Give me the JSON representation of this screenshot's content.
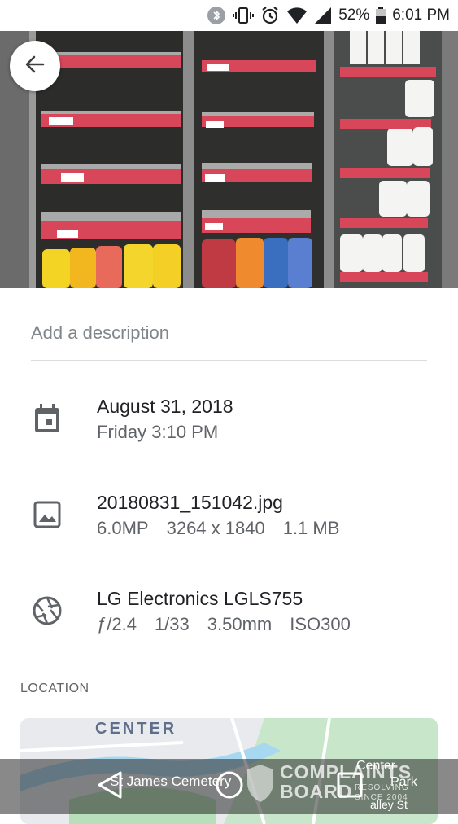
{
  "status_bar": {
    "battery": "52%",
    "time": "6:01 PM",
    "icons": [
      "bluetooth-icon",
      "vibrate-icon",
      "alarm-icon",
      "wifi-icon",
      "signal-icon",
      "battery-icon"
    ]
  },
  "photo": {
    "icons": [
      "back-arrow-icon"
    ]
  },
  "details": {
    "description_placeholder": "Add a description",
    "date": {
      "icon": "calendar-icon",
      "date": "August 31, 2018",
      "day_time": "Friday 3:10 PM"
    },
    "file": {
      "icon": "image-icon",
      "filename": "20180831_151042.jpg",
      "megapixels": "6.0MP",
      "resolution": "3264 x 1840",
      "size": "1.1 MB"
    },
    "camera": {
      "icon": "aperture-icon",
      "model": "LG Electronics LGLS755",
      "aperture": "ƒ/2.4",
      "shutter": "1/33",
      "focal_length": "3.50mm",
      "iso": "ISO300"
    },
    "location_label": "LOCATION"
  },
  "map": {
    "labels": {
      "center": "CENTER",
      "cemetery": "St James Cemetery",
      "center_right": "Center",
      "park": "Park",
      "street": "alley St"
    }
  },
  "watermark": {
    "line1": "COMPLAINTS",
    "line2": "BOARD",
    "line3": "RESOLVING",
    "line4": "SINCE 2004"
  },
  "nav_bar": {
    "icons": [
      "back-triangle-icon",
      "home-circle-icon",
      "recents-square-icon"
    ]
  },
  "colors": {
    "shelf_red": "#d8465a",
    "text_primary": "#202124",
    "text_secondary": "#5f6368",
    "placeholder": "#80868b"
  }
}
